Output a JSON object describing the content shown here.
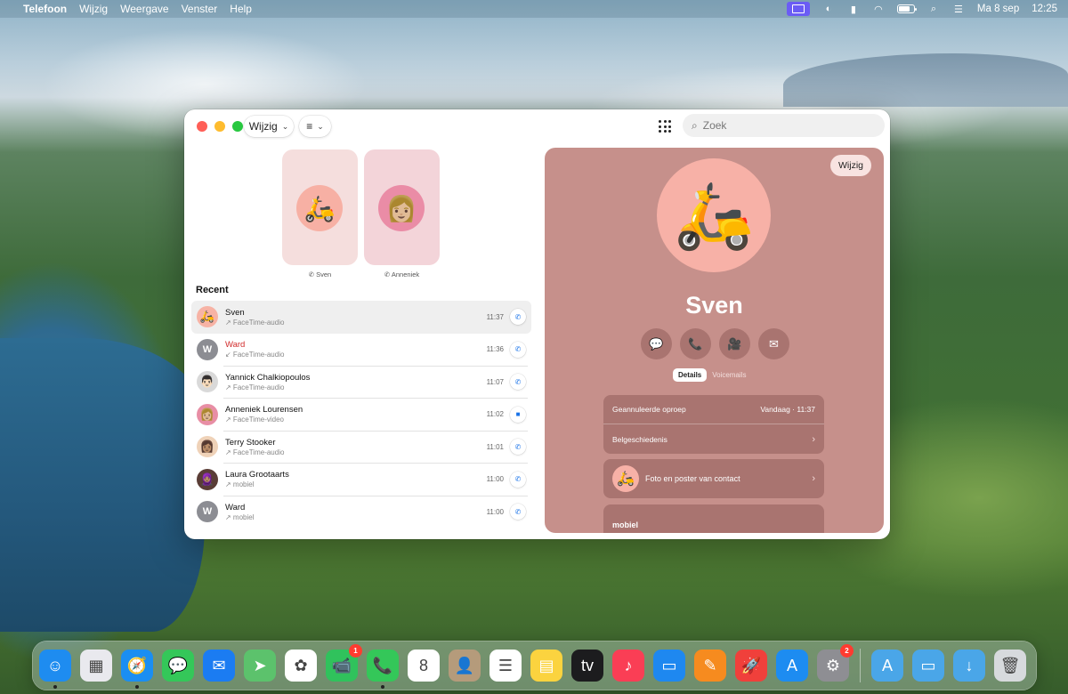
{
  "menubar": {
    "app_name": "Telefoon",
    "menus": [
      "Wijzig",
      "Weergave",
      "Venster",
      "Help"
    ],
    "date": "Ma 8 sep",
    "time": "12:25",
    "icons": [
      "screen-mirroring-icon",
      "contrast-icon",
      "device-icon",
      "wifi-icon",
      "battery-icon",
      "search-icon",
      "control-center-icon"
    ]
  },
  "toolbar": {
    "edit_label": "Wijzig",
    "search_placeholder": "Zoek"
  },
  "favorites": [
    {
      "name": "Sven",
      "emoji": "🛵"
    },
    {
      "name": "Anneniek",
      "emoji": "👩🏼"
    }
  ],
  "recents": {
    "title": "Recent",
    "items": [
      {
        "name": "Sven",
        "type": "↗ FaceTime-audio",
        "time": "11:37",
        "avatar": "🛵",
        "missed": false,
        "call_icon": "phone-icon"
      },
      {
        "name": "Ward",
        "type": "↙ FaceTime-audio",
        "time": "11:36",
        "avatar": "W",
        "missed": true,
        "call_icon": "phone-icon"
      },
      {
        "name": "Yannick Chalkiopoulos",
        "type": "↗ FaceTime-audio",
        "time": "11:07",
        "avatar": "👨🏻",
        "missed": false,
        "call_icon": "phone-icon"
      },
      {
        "name": "Anneniek Lourensen",
        "type": "↗ FaceTime-video",
        "time": "11:02",
        "avatar": "👩🏼",
        "missed": false,
        "call_icon": "video-icon"
      },
      {
        "name": "Terry Stooker",
        "type": "↗ FaceTime-audio",
        "time": "11:01",
        "avatar": "👩🏽",
        "missed": false,
        "call_icon": "phone-icon"
      },
      {
        "name": "Laura Grootaarts",
        "type": "↗ mobiel",
        "time": "11:00",
        "avatar": "🧕🏽",
        "missed": false,
        "call_icon": "phone-icon"
      },
      {
        "name": "Ward",
        "type": "↗ mobiel",
        "time": "11:00",
        "avatar": "W",
        "missed": false,
        "call_icon": "phone-icon"
      }
    ]
  },
  "detail": {
    "edit_label": "Wijzig",
    "name": "Sven",
    "avatar": "🛵",
    "actions": [
      {
        "name": "message-icon",
        "glyph": "💬"
      },
      {
        "name": "phone-icon",
        "glyph": "📞"
      },
      {
        "name": "video-icon",
        "glyph": "🎥"
      },
      {
        "name": "mail-icon",
        "glyph": "✉"
      }
    ],
    "tabs": [
      "Details",
      "Voicemails"
    ],
    "cancelled_call_label": "Geannuleerde oproep",
    "cancelled_call_time": "Vandaag · 11:37",
    "call_history_label": "Belgeschiedenis",
    "photo_poster_label": "Foto en poster van contact",
    "mobile_label": "mobiel"
  },
  "dock": {
    "apps": [
      {
        "name": "finder-icon",
        "bg": "#1e8cf0",
        "glyph": "☺",
        "running": true
      },
      {
        "name": "launchpad-icon",
        "bg": "#e9e9ee",
        "glyph": "▦",
        "running": false
      },
      {
        "name": "safari-icon",
        "bg": "#1a8ef2",
        "glyph": "🧭",
        "running": true
      },
      {
        "name": "messages-icon",
        "bg": "#34c759",
        "glyph": "💬",
        "running": false
      },
      {
        "name": "mail-icon",
        "bg": "#1b7cf2",
        "glyph": "✉",
        "running": false
      },
      {
        "name": "maps-icon",
        "bg": "#5cc26c",
        "glyph": "➤",
        "running": false
      },
      {
        "name": "photos-icon",
        "bg": "#ffffff",
        "glyph": "✿",
        "running": false
      },
      {
        "name": "facetime-icon",
        "bg": "#30c25c",
        "glyph": "📹",
        "running": false,
        "badge": "1"
      },
      {
        "name": "phone-icon",
        "bg": "#34c759",
        "glyph": "📞",
        "running": true
      },
      {
        "name": "calendar-icon",
        "bg": "#ffffff",
        "glyph": "8",
        "running": false
      },
      {
        "name": "contacts-icon",
        "bg": "#b59b7b",
        "glyph": "👤",
        "running": false
      },
      {
        "name": "reminders-icon",
        "bg": "#ffffff",
        "glyph": "☰",
        "running": false
      },
      {
        "name": "notes-icon",
        "bg": "#fbd33f",
        "glyph": "▤",
        "running": false
      },
      {
        "name": "tv-icon",
        "bg": "#1c1c1e",
        "glyph": "tv",
        "running": false
      },
      {
        "name": "music-icon",
        "bg": "#fa3e55",
        "glyph": "♪",
        "running": false
      },
      {
        "name": "keynote-icon",
        "bg": "#1e88f0",
        "glyph": "▭",
        "running": false
      },
      {
        "name": "pages-icon",
        "bg": "#f68b1f",
        "glyph": "✎",
        "running": false
      },
      {
        "name": "rocket-icon",
        "bg": "#f0403b",
        "glyph": "🚀",
        "running": false
      },
      {
        "name": "app-store-icon",
        "bg": "#1d8cf1",
        "glyph": "A",
        "running": false
      },
      {
        "name": "settings-icon",
        "bg": "#8e8e93",
        "glyph": "⚙",
        "running": false,
        "badge": "2"
      }
    ],
    "folders": [
      {
        "name": "applications-folder-icon",
        "bg": "#4aa6e8",
        "glyph": "A"
      },
      {
        "name": "documents-folder-icon",
        "bg": "#4aa6e8",
        "glyph": "▭"
      },
      {
        "name": "downloads-folder-icon",
        "bg": "#4aa6e8",
        "glyph": "↓"
      },
      {
        "name": "trash-icon",
        "bg": "#d7dadd",
        "glyph": "🗑"
      }
    ]
  }
}
